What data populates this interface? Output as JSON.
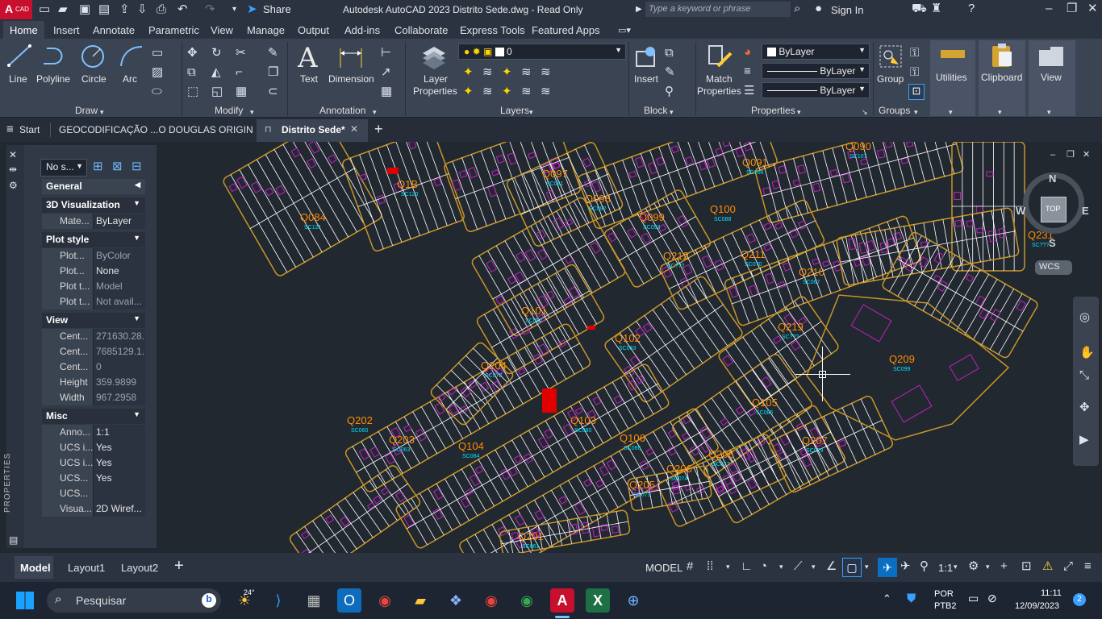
{
  "titlebar": {
    "app_badge": "CAD",
    "app_letter": "A",
    "share_label": "Share",
    "title": "Autodesk AutoCAD 2023   Distrito Sede.dwg - Read Only",
    "search_placeholder": "Type a keyword or phrase",
    "sign_in": "Sign In"
  },
  "ribbon_tabs": [
    "Home",
    "Insert",
    "Annotate",
    "Parametric",
    "View",
    "Manage",
    "Output",
    "Add-ins",
    "Collaborate",
    "Express Tools",
    "Featured Apps"
  ],
  "ribbon": {
    "draw": {
      "title": "Draw",
      "line": "Line",
      "polyline": "Polyline",
      "circle": "Circle",
      "arc": "Arc"
    },
    "modify": {
      "title": "Modify"
    },
    "annotation": {
      "title": "Annotation",
      "text": "Text",
      "dimension": "Dimension"
    },
    "layers": {
      "title": "Layers",
      "layer_properties_1": "Layer",
      "layer_properties_2": "Properties",
      "current_layer": "0"
    },
    "block": {
      "title": "Block",
      "insert": "Insert"
    },
    "properties": {
      "title": "Properties",
      "match_1": "Match",
      "match_2": "Properties",
      "color": "ByLayer",
      "linetype": "ByLayer",
      "lineweight": "ByLayer"
    },
    "groups": {
      "title": "Groups",
      "group": "Group"
    },
    "utilities": "Utilities",
    "clipboard": "Clipboard",
    "view": "View"
  },
  "doc_tabs": {
    "start": "Start",
    "tab1": "GEOCODIFICAÇÃO ...O DOUGLAS ORIGIN",
    "tab2": "Distrito Sede*"
  },
  "properties_palette": {
    "selection": "No s...",
    "vertical_label": "PROPERTIES",
    "general": "General",
    "sections": [
      {
        "title": "3D Visualization",
        "rows": [
          {
            "k": "Mate...",
            "v": "ByLayer",
            "dim": false
          }
        ]
      },
      {
        "title": "Plot style",
        "rows": [
          {
            "k": "Plot...",
            "v": "ByColor",
            "dim": true
          },
          {
            "k": "Plot...",
            "v": "None",
            "dim": false
          },
          {
            "k": "Plot t...",
            "v": "Model",
            "dim": true
          },
          {
            "k": "Plot t...",
            "v": "Not avail...",
            "dim": true
          }
        ]
      },
      {
        "title": "View",
        "rows": [
          {
            "k": "Cent...",
            "v": "271630.28...",
            "dim": true
          },
          {
            "k": "Cent...",
            "v": "7685129.1...",
            "dim": true
          },
          {
            "k": "Cent...",
            "v": "0",
            "dim": true
          },
          {
            "k": "Height",
            "v": "359.9899",
            "dim": true
          },
          {
            "k": "Width",
            "v": "967.2958",
            "dim": true
          }
        ]
      },
      {
        "title": "Misc",
        "rows": [
          {
            "k": "Anno...",
            "v": "1:1",
            "dim": false
          },
          {
            "k": "UCS i...",
            "v": "Yes",
            "dim": false
          },
          {
            "k": "UCS i...",
            "v": "Yes",
            "dim": false
          },
          {
            "k": "UCS...",
            "v": "Yes",
            "dim": false
          },
          {
            "k": "UCS...",
            "v": "",
            "dim": false
          },
          {
            "k": "Visua...",
            "v": "2D Wiref...",
            "dim": false
          }
        ]
      }
    ]
  },
  "viewcube": {
    "north": "N",
    "south": "S",
    "east": "E",
    "west": "W",
    "top": "TOP",
    "wcs": "WCS"
  },
  "block_labels": [
    {
      "q": "Q097",
      "s": "SC091"
    },
    {
      "q": "Q091",
      "s": "SC106"
    },
    {
      "q": "Q090",
      "s": "SC107"
    },
    {
      "q": "Q098",
      "s": "SC092"
    },
    {
      "q": "Q099",
      "s": "SC093"
    },
    {
      "q": "Q100",
      "s": "SC088"
    },
    {
      "q": "Q084",
      "s": "SC121"
    },
    {
      "q": "Q212",
      "s": "SC???"
    },
    {
      "q": "Q211",
      "s": "SC070"
    },
    {
      "q": "Q210",
      "s": "SC067"
    },
    {
      "q": "Q231",
      "s": "SC???"
    },
    {
      "q": "Q101",
      "s": "SC082"
    },
    {
      "q": "Q102",
      "s": "SC083"
    },
    {
      "q": "Q104",
      "s": "SC084"
    },
    {
      "q": "Q219",
      "s": "SC???"
    },
    {
      "q": "Q209",
      "s": "SC099"
    },
    {
      "q": "Q202",
      "s": "SC060"
    },
    {
      "q": "Q203",
      "s": "SC063"
    },
    {
      "q": "Q103",
      "s": "SC080"
    },
    {
      "q": "Q105",
      "s": "SC085"
    },
    {
      "q": "Q207",
      "s": "SC079"
    },
    {
      "q": "Q208",
      "s": "SC077"
    },
    {
      "q": "Q206",
      "s": "SC074"
    },
    {
      "q": "Q205",
      "s": "SC073"
    },
    {
      "q": "Q204",
      "s": "SC072"
    },
    {
      "q": "Q201",
      "s": "SC061"
    },
    {
      "q": "Q106",
      "s": "SC086"
    },
    {
      "q": "Q1B",
      "s": "SC120"
    }
  ],
  "statusbar": {
    "model_tab": "Model",
    "layout1": "Layout1",
    "layout2": "Layout2",
    "model_space": "MODEL",
    "scale": "1:1"
  },
  "taskbar": {
    "search": "Pesquisar",
    "weather": "24°",
    "lang1": "POR",
    "lang2": "PTB2",
    "time": "11:11",
    "date": "12/09/2023",
    "notif": "2"
  },
  "colors": {
    "lot_lines": "#ffffff",
    "buildings": "#c020c0",
    "blocks_outline": "#c89628",
    "block_labels": "#ff8c00",
    "sector_labels": "#00e5ff",
    "accent_blue": "#0a6fc2"
  }
}
